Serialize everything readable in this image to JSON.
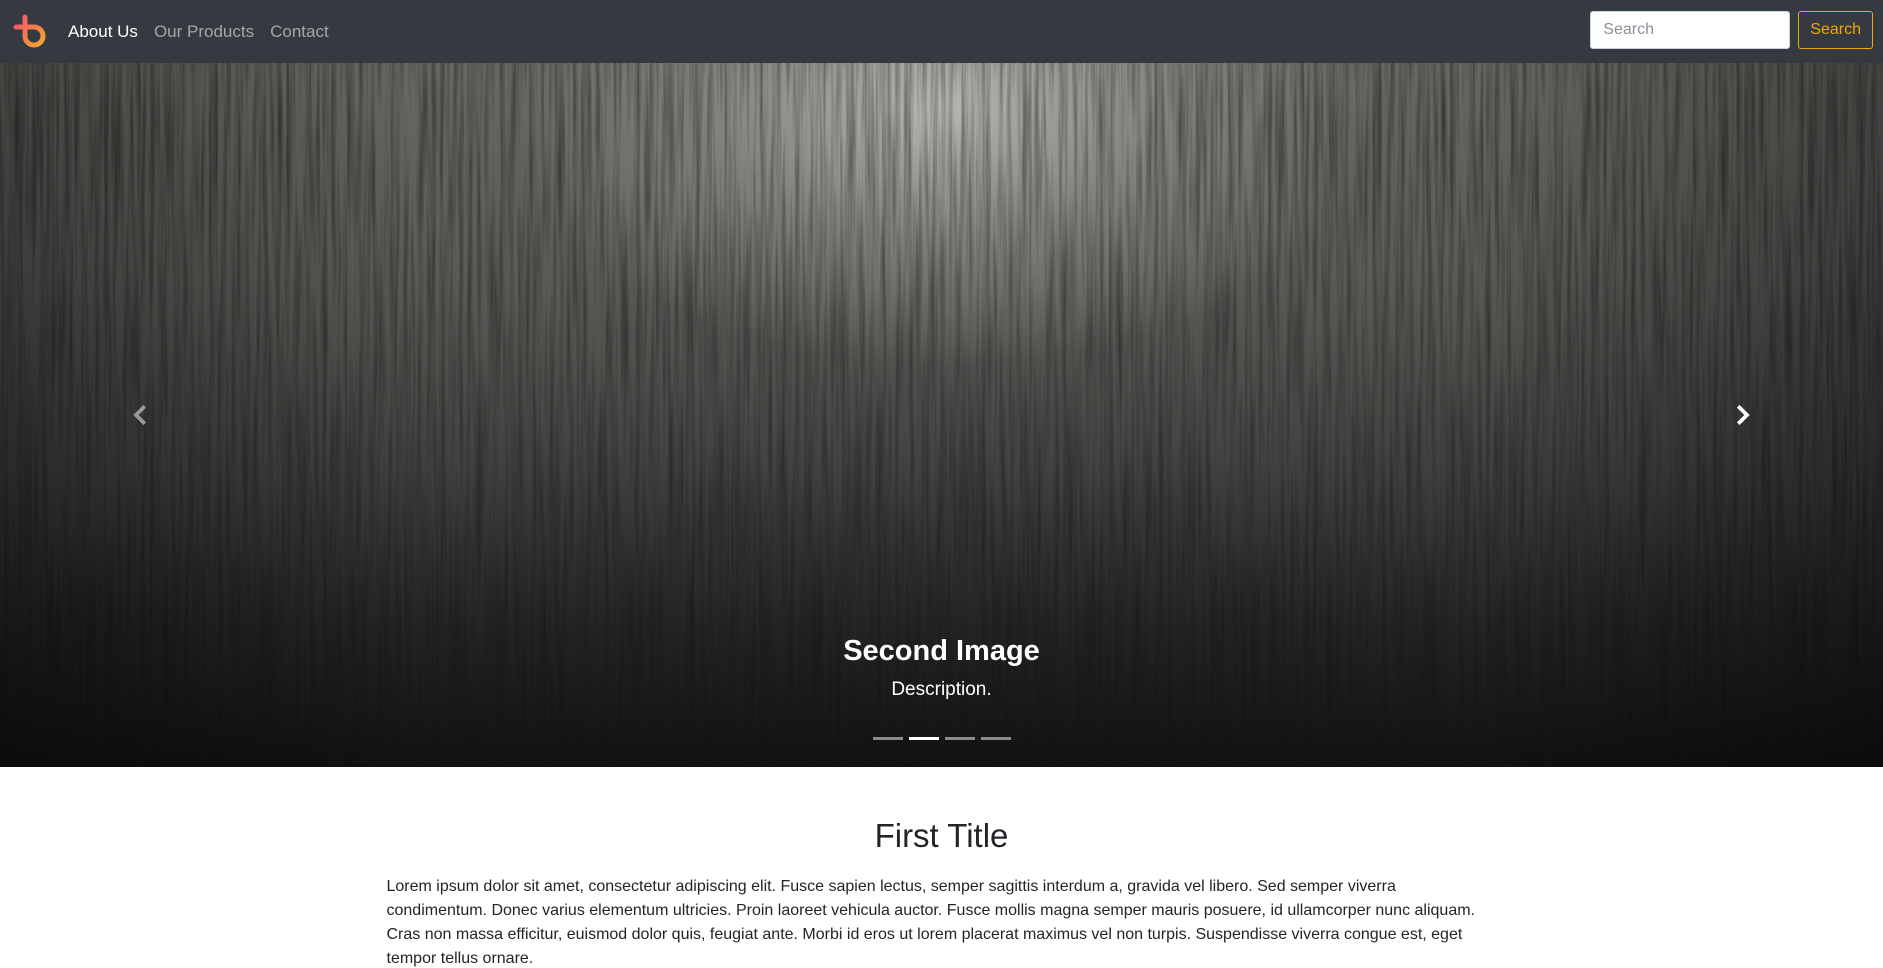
{
  "navbar": {
    "brand_icon": "logo-icon",
    "links": [
      {
        "label": "About Us",
        "active": true
      },
      {
        "label": "Our Products",
        "active": false
      },
      {
        "label": "Contact",
        "active": false
      }
    ],
    "search": {
      "placeholder": "Search",
      "button_label": "Search"
    }
  },
  "carousel": {
    "prev_icon": "chevron-left-icon",
    "next_icon": "chevron-right-icon",
    "active_slide": {
      "title": "Second Image",
      "description": "Description."
    },
    "indicator_count": 4,
    "active_index": 1
  },
  "section": {
    "title": "First Title",
    "text": "Lorem ipsum dolor sit amet, consectetur adipiscing elit. Fusce sapien lectus, semper sagittis interdum a, gravida vel libero. Sed semper viverra condimentum. Donec varius elementum ultricies. Proin laoreet vehicula auctor. Fusce mollis magna semper mauris posuere, id ullamcorper nunc aliquam. Cras non massa efficitur, euismod dolor quis, feugiat ante. Morbi id eros ut lorem placerat maximus vel non turpis. Suspendisse viverra congue est, eget tempor tellus ornare."
  },
  "colors": {
    "navbar_bg": "#343a40",
    "accent": "#f6a609",
    "logo_gradient": [
      "#f0506e",
      "#f7a530"
    ]
  }
}
